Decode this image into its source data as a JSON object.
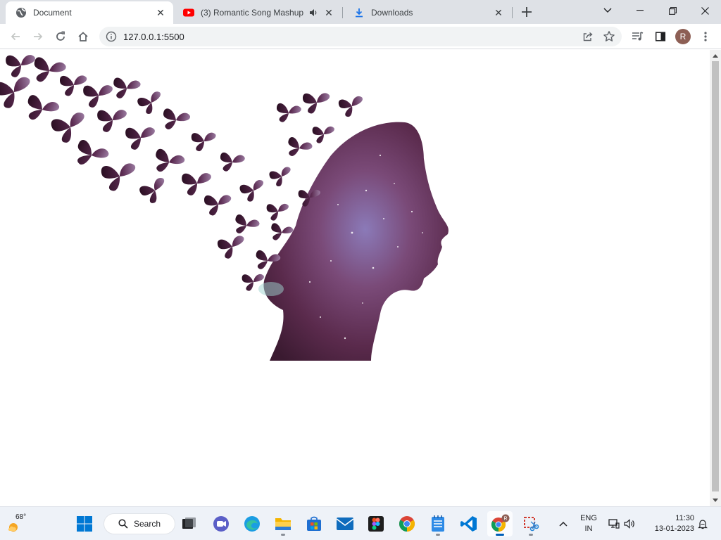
{
  "browser": {
    "tabs": [
      {
        "title": "Document",
        "icon": "globe-icon",
        "active": true
      },
      {
        "title": "(3) Romantic Song Mashup |",
        "icon": "youtube-icon",
        "audio": true,
        "active": false
      },
      {
        "title": "Downloads",
        "icon": "download-icon",
        "active": false
      }
    ],
    "address": {
      "url": "127.0.0.1:5500"
    },
    "profile_initial": "R",
    "accent": "#1a73e8"
  },
  "page": {
    "image": "woman-silhouette-butterflies-galaxy",
    "background": "#ffffff"
  },
  "taskbar": {
    "weather": {
      "temp": "68°"
    },
    "search_label": "Search",
    "apps": [
      "start-icon",
      "task-view-icon",
      "teams-chat-icon",
      "edge-icon",
      "file-explorer-icon",
      "microsoft-store-icon",
      "mail-icon",
      "figma-icon",
      "chrome-icon",
      "notepad-icon",
      "vscode-icon",
      "chrome-profile-icon",
      "snipping-tool-icon"
    ],
    "language": {
      "line1": "ENG",
      "line2": "IN"
    },
    "clock": {
      "time": "11:30",
      "date": "13-01-2023"
    }
  }
}
